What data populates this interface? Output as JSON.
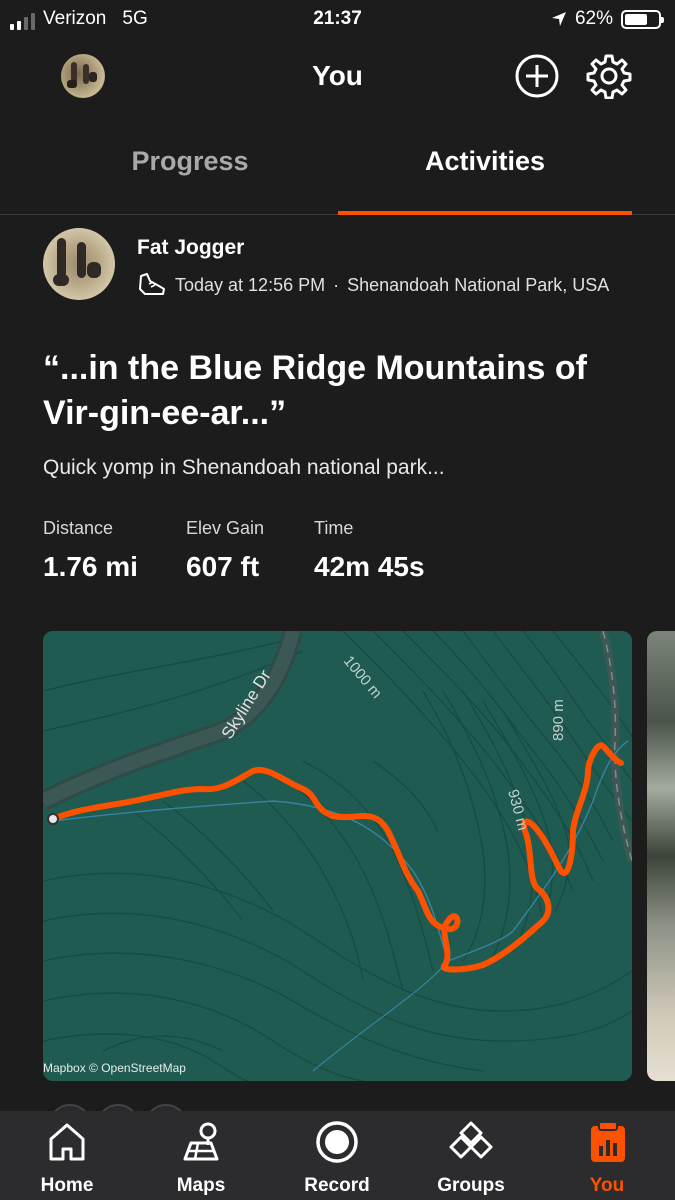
{
  "status_bar": {
    "carrier": "Verizon",
    "network": "5G",
    "time": "21:37",
    "battery": "62%",
    "battery_level": 0.62
  },
  "header": {
    "title": "You",
    "add_icon": "plus-circle-icon",
    "settings_icon": "gear-icon"
  },
  "tabs": [
    {
      "label": "Progress",
      "active": false
    },
    {
      "label": "Activities",
      "active": true
    }
  ],
  "activity": {
    "athlete_name": "Fat Jogger",
    "sport_icon": "shoe-icon",
    "timestamp": "Today at 12:56 PM",
    "separator": "·",
    "location": "Shenandoah National Park, USA",
    "title_line1": "“...in the Blue Ridge Mountains of",
    "title_line2": "Vir-gin-ee-ar...”",
    "description": "Quick yomp in Shenandoah national park...",
    "stats": [
      {
        "label": "Distance",
        "value": "1.76 mi"
      },
      {
        "label": "Elev Gain",
        "value": "607 ft"
      },
      {
        "label": "Time",
        "value": "42m 45s"
      }
    ],
    "map": {
      "road_label": "Skyline Dr",
      "contour_labels": [
        "1000 m",
        "890 m",
        "930 m"
      ],
      "attribution": "Mapbox © OpenStreetMap",
      "route_color": "#fc5200",
      "background_color": "#1e5a50"
    }
  },
  "tab_bar": [
    {
      "label": "Home",
      "icon": "home-icon",
      "active": false
    },
    {
      "label": "Maps",
      "icon": "map-icon",
      "active": false
    },
    {
      "label": "Record",
      "icon": "record-icon",
      "active": false
    },
    {
      "label": "Groups",
      "icon": "groups-icon",
      "active": false
    },
    {
      "label": "You",
      "icon": "you-icon",
      "active": true
    }
  ],
  "colors": {
    "accent": "#fc5200",
    "background": "#1c1c1d",
    "tab_bar": "#2c2c2e"
  }
}
